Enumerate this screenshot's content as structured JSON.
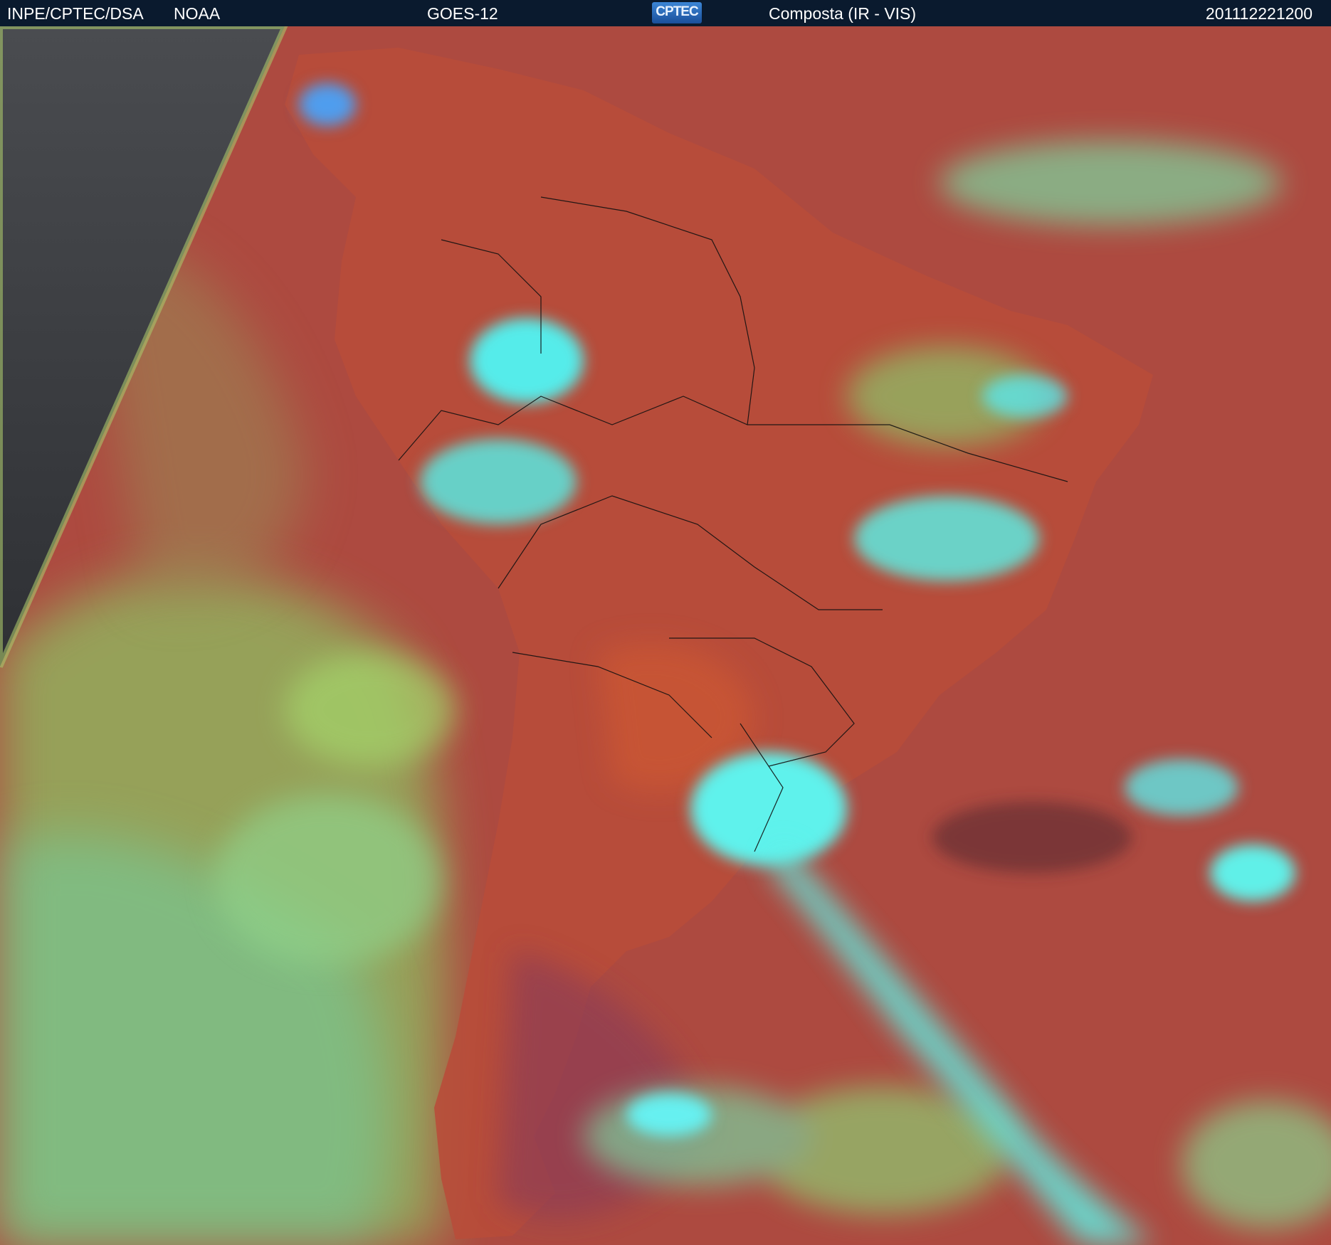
{
  "header": {
    "source": "INPE/CPTEC/DSA",
    "agency": "NOAA",
    "satellite": "GOES-12",
    "logo_text": "CPTEC",
    "product": "Composta (IR - VIS)",
    "timestamp": "201112221200"
  },
  "colors": {
    "header_bg": "#0a1a2e",
    "land_red": "#b5493f",
    "ocean_red": "#a8473f",
    "cloud_cyan": "#4ef0e6",
    "low_cloud_green": "#9ed36a",
    "night_gray": "#3a3d42"
  }
}
